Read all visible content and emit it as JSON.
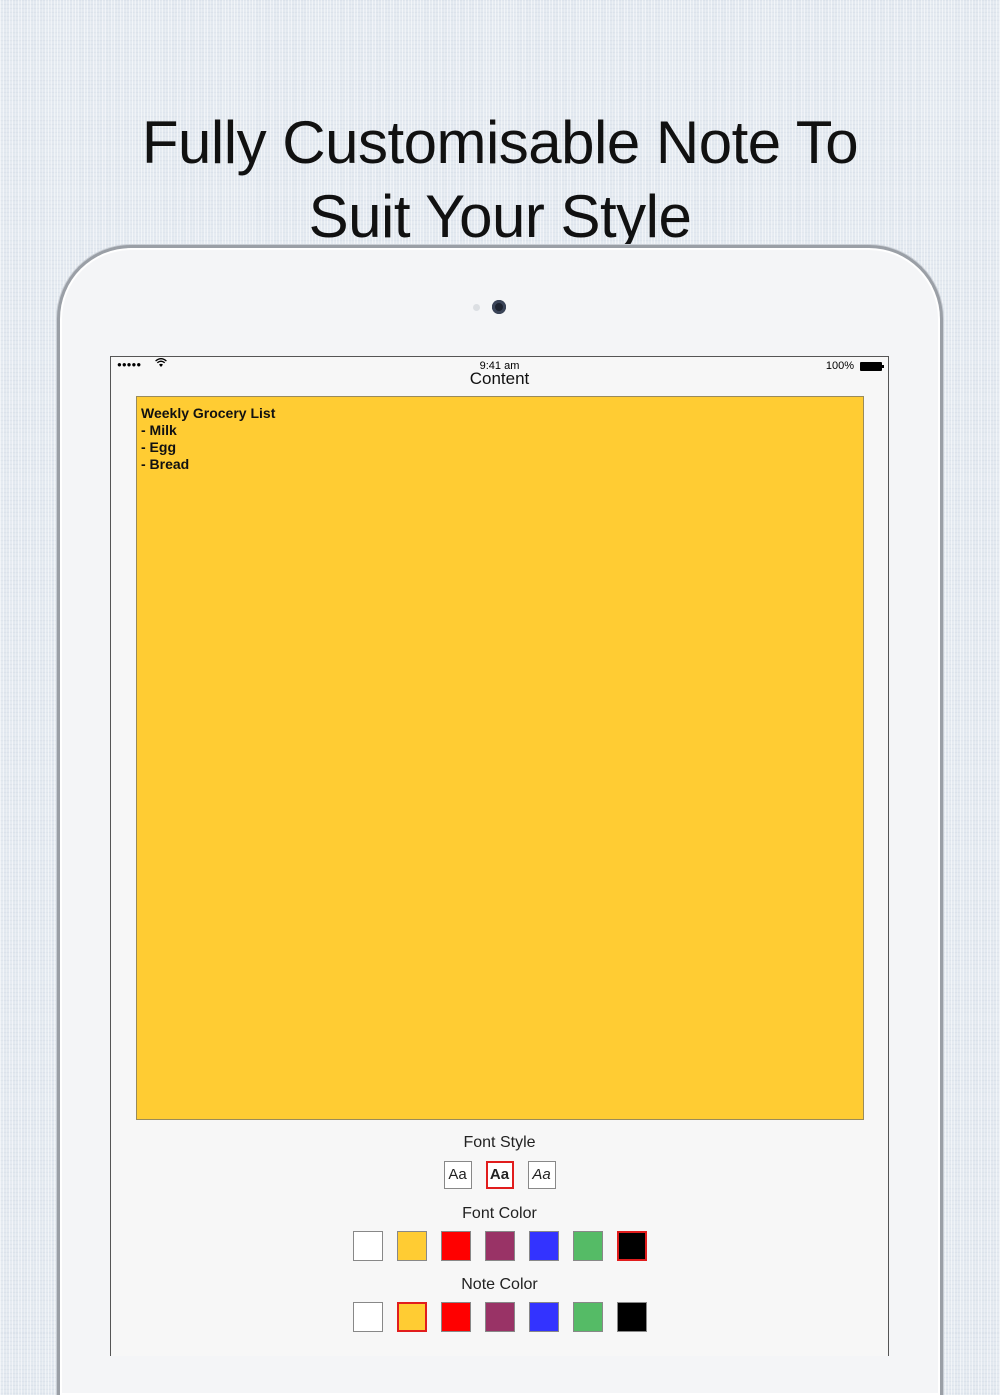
{
  "headline": {
    "line1": "Fully Customisable Note To",
    "line2": "Suit Your Style"
  },
  "status_bar": {
    "signal": "●●●●●",
    "wifi_icon": "wifi-icon",
    "time": "9:41 am",
    "battery": "100%"
  },
  "nav": {
    "title": "Content"
  },
  "note": {
    "background": "#ffcc33",
    "lines": [
      "Weekly Grocery List",
      "- Milk",
      "- Egg",
      "- Bread"
    ]
  },
  "font_style": {
    "label": "Font Style",
    "options": [
      {
        "label": "Aa",
        "style": "regular",
        "selected": false
      },
      {
        "label": "Aa",
        "style": "bold",
        "selected": true
      },
      {
        "label": "Aa",
        "style": "italic",
        "selected": false
      }
    ]
  },
  "font_color": {
    "label": "Font Color",
    "swatches": [
      "#ffffff",
      "#ffcc33",
      "#ff0000",
      "#993366",
      "#3333ff",
      "#55bb66",
      "#000000"
    ],
    "selected_index": 6
  },
  "note_color": {
    "label": "Note Color",
    "swatches": [
      "#ffffff",
      "#ffcc33",
      "#ff0000",
      "#993366",
      "#3333ff",
      "#55bb66",
      "#000000"
    ],
    "selected_index": 1
  }
}
